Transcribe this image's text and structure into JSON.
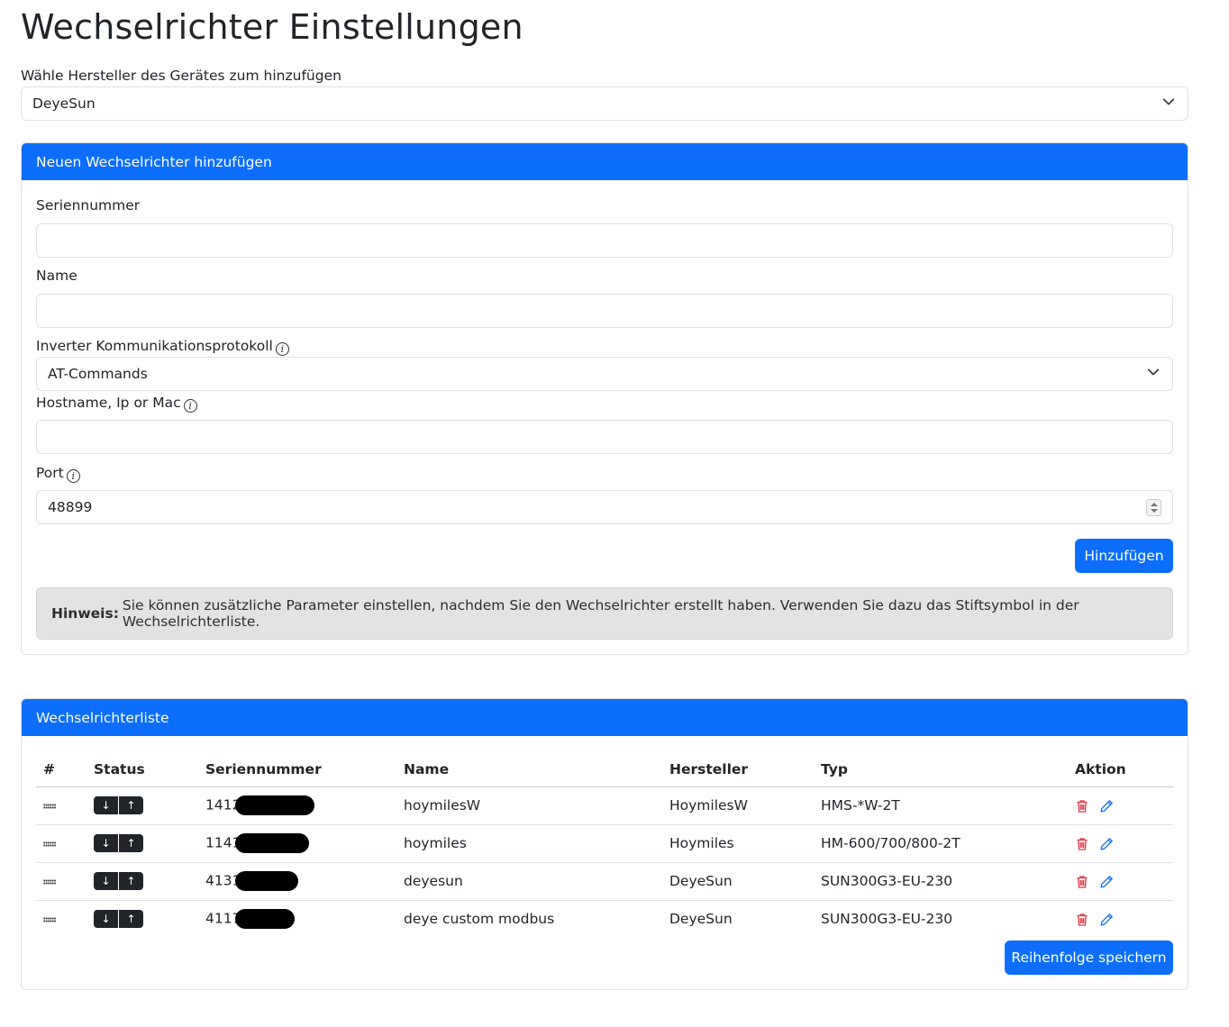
{
  "page": {
    "title": "Wechselrichter Einstellungen",
    "manufacturer_label": "Wähle Hersteller des Gerätes zum hinzufügen",
    "manufacturer_value": "DeyeSun"
  },
  "add_form": {
    "header": "Neuen Wechselrichter hinzufügen",
    "serial_label": "Seriennummer",
    "serial_value": "",
    "name_label": "Name",
    "name_value": "",
    "protocol_label": "Inverter Kommunikationsprotokoll",
    "protocol_value": "AT-Commands",
    "host_label": "Hostname, Ip or Mac",
    "host_value": "",
    "port_label": "Port",
    "port_value": "48899",
    "add_button": "Hinzufügen",
    "note_bold": "Hinweis:",
    "note_text": "Sie können zusätzliche Parameter einstellen, nachdem Sie den Wechselrichter erstellt haben. Verwenden Sie dazu das Stiftsymbol in der Wechselrichterliste."
  },
  "list": {
    "header": "Wechselrichterliste",
    "columns": [
      "#",
      "Status",
      "Seriennummer",
      "Name",
      "Hersteller",
      "Typ",
      "Aktion"
    ],
    "rows": [
      {
        "serial": "1412",
        "name": "hoymilesW",
        "manufacturer": "HoymilesW",
        "type": "HMS-*W-2T"
      },
      {
        "serial": "1141",
        "name": "hoymiles",
        "manufacturer": "Hoymiles",
        "type": "HM-600/700/800-2T"
      },
      {
        "serial": "4131",
        "name": "deyesun",
        "manufacturer": "DeyeSun",
        "type": "SUN300G3-EU-230"
      },
      {
        "serial": "4117",
        "name": "deye custom modbus",
        "manufacturer": "DeyeSun",
        "type": "SUN300G3-EU-230"
      }
    ],
    "down_glyph": "↓",
    "up_glyph": "↑",
    "save_order_button": "Reihenfolge speichern"
  },
  "colors": {
    "primary": "#0d6efd",
    "danger": "#dc3545",
    "note_bg": "#e2e3e5",
    "dark": "#212529"
  },
  "icons": [
    "chevron-down-icon",
    "info-icon",
    "drag-handle-icon",
    "arrow-down-icon",
    "arrow-up-icon",
    "trash-icon",
    "pencil-icon"
  ]
}
